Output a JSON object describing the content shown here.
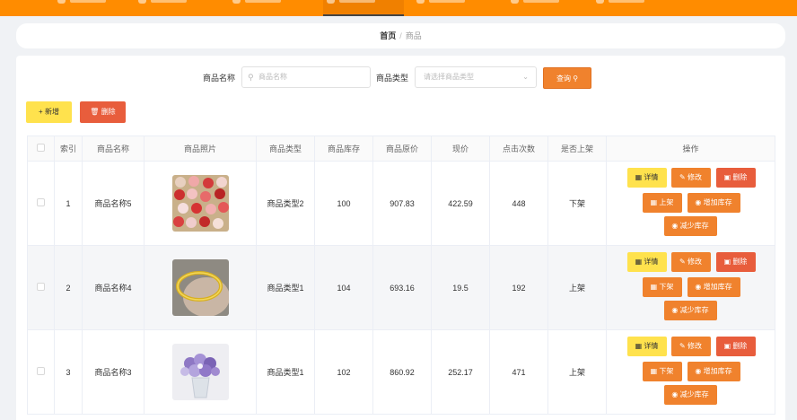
{
  "breadcrumb": {
    "home": "首页",
    "separator": "/",
    "current": "商品"
  },
  "search": {
    "name_label": "商品名称",
    "name_placeholder": "商品名称",
    "type_label": "商品类型",
    "type_placeholder": "请选择商品类型",
    "query_label": "查询"
  },
  "actions": {
    "add_label": "新增",
    "delete_label": "删除"
  },
  "table": {
    "headers": [
      "索引",
      "商品名称",
      "商品照片",
      "商品类型",
      "商品库存",
      "商品原价",
      "现价",
      "点击次数",
      "是否上架",
      "操作"
    ],
    "rows": [
      {
        "index": "1",
        "name": "商品名称5",
        "type": "商品类型2",
        "stock": "100",
        "original_price": "907.83",
        "price": "422.59",
        "clicks": "448",
        "on_shelf": "下架",
        "shelf_action": "上架",
        "photo": "flower-bouquet-red-pink"
      },
      {
        "index": "2",
        "name": "商品名称4",
        "type": "商品类型1",
        "stock": "104",
        "original_price": "693.16",
        "price": "19.5",
        "clicks": "192",
        "on_shelf": "上架",
        "shelf_action": "下架",
        "photo": "gold-bracelet"
      },
      {
        "index": "3",
        "name": "商品名称3",
        "type": "商品类型1",
        "stock": "102",
        "original_price": "860.92",
        "price": "252.17",
        "clicks": "471",
        "on_shelf": "上架",
        "shelf_action": "下架",
        "photo": "purple-flower-vase"
      }
    ],
    "op_labels": {
      "detail": "详情",
      "edit": "修改",
      "delete": "删除",
      "increase": "增加库存",
      "decrease": "减少库存"
    }
  },
  "colors": {
    "nav": "#ff8c00",
    "primary": "#f0822d",
    "danger": "#e85d3c",
    "warning": "#ffe24d"
  }
}
